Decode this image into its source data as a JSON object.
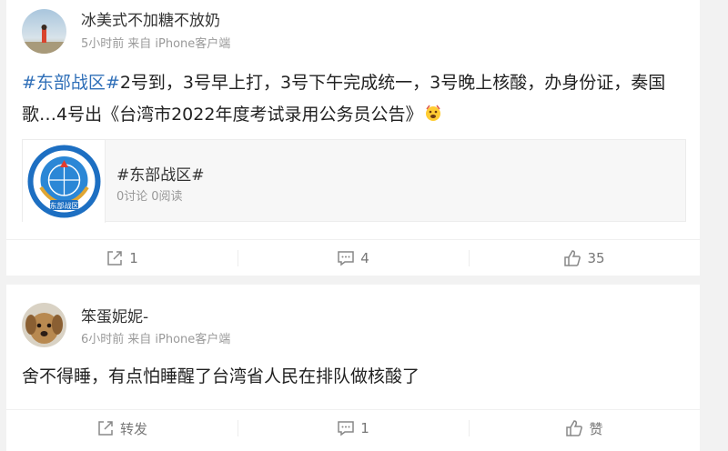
{
  "posts": [
    {
      "author": "冰美式不加糖不放奶",
      "time": "5小时前",
      "source": "来自 iPhone客户端",
      "text_parts": [
        {
          "text": "#东部战区#",
          "link": true
        },
        {
          "text": "2号到，3号早上打，3号下午完成统一，3号晚上核酸，办身份证，奏国歌…4号出《台湾市2022年度考试录用公务员公告》",
          "link": false
        }
      ],
      "topic": {
        "title": "#东部战区#",
        "discussions": "0讨论",
        "reads": "0阅读",
        "logo_text": "东部战区"
      },
      "actions": {
        "forward": "1",
        "comment": "4",
        "like": "35"
      }
    },
    {
      "author": "笨蛋妮妮-",
      "time": "6小时前",
      "source": "来自 iPhone客户端",
      "text": "舍不得睡，有点怕睡醒了台湾省人民在排队做核酸了",
      "actions": {
        "forward": "转发",
        "comment": "1",
        "like": "赞"
      }
    }
  ],
  "colors": {
    "link": "#2f6fb8",
    "background": "#f2f2f2"
  },
  "icons": [
    "forward-icon",
    "comment-icon",
    "like-icon",
    "emoji-icon"
  ]
}
